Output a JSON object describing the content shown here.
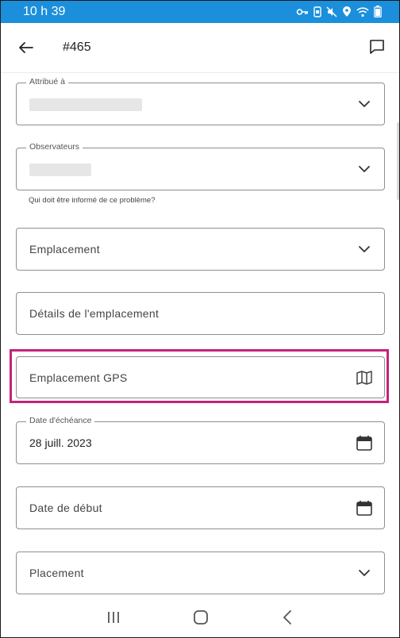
{
  "status_bar": {
    "time": "10 h 39",
    "icons": [
      "key-icon",
      "nfc-icon",
      "mute-icon",
      "location-icon",
      "wifi-icon",
      "battery-icon"
    ]
  },
  "app_bar": {
    "title": "#465",
    "back_icon": "arrow-left-icon",
    "comment_icon": "comment-icon"
  },
  "form": {
    "attribue_a": {
      "label": "Attribué à",
      "value_redacted": true
    },
    "observateurs": {
      "label": "Observateurs",
      "value_redacted": true,
      "helper": "Qui doit être informé de ce problème?"
    },
    "emplacement": {
      "placeholder": "Emplacement"
    },
    "details_emplacement": {
      "placeholder": "Détails de l'emplacement"
    },
    "emplacement_gps": {
      "placeholder": "Emplacement GPS",
      "icon": "map-icon",
      "highlighted": true
    },
    "date_echeance": {
      "label": "Date d'échéance",
      "value": "28 juill. 2023",
      "icon": "calendar-icon"
    },
    "date_debut": {
      "placeholder": "Date de début",
      "icon": "calendar-icon"
    },
    "placement": {
      "placeholder": "Placement"
    }
  },
  "nav_bar": {
    "icons": [
      "recents-icon",
      "home-icon",
      "back-icon"
    ]
  },
  "colors": {
    "status_bar": "#1b8fdc",
    "highlight": "#c1247a",
    "field_border": "#8f8f8f"
  }
}
